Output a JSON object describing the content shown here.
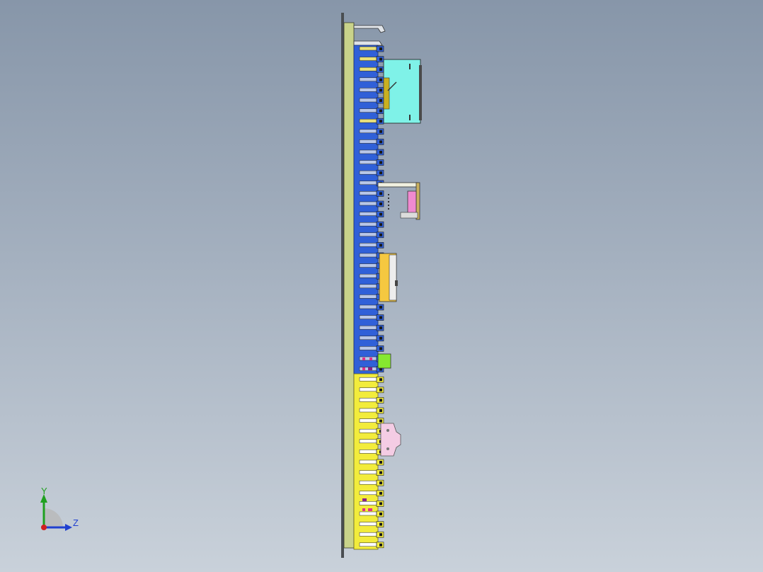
{
  "viewport": {
    "background_top": "#8796a9",
    "background_bottom": "#c9d1da"
  },
  "assembly": {
    "frame_color": "#c9d38a",
    "blue_rail_color": "#3060d8",
    "yellow_rail_color": "#f2ec3c",
    "terminal_light_color": "#b8c6e8",
    "terminal_yellow_color": "#e8e07a",
    "components": [
      {
        "name": "cyan-module",
        "color": "#7ff2e8"
      },
      {
        "name": "pink-relay",
        "color": "#f08ad0"
      },
      {
        "name": "orange-breaker",
        "color": "#f5c840"
      },
      {
        "name": "green-block",
        "color": "#86e830"
      },
      {
        "name": "pale-pink-connector",
        "color": "#f4cce4"
      }
    ]
  },
  "triad": {
    "y_label": "Y",
    "z_label": "Z",
    "y_color": "#1fa01f",
    "z_color": "#2040d0",
    "origin_color": "#d02020"
  }
}
